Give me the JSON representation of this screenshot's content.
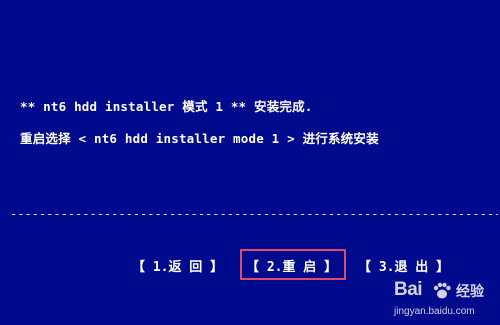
{
  "screen": {
    "line1": "** nt6 hdd installer 模式 1 ** 安装完成.",
    "line2": "重启选择 < nt6 hdd installer mode 1 > 进行系统安装",
    "divider": "--------------------------------------------------------------------------------------"
  },
  "menu": {
    "item1": "【 1.返 回 】",
    "item2": "【 2.重 启 】",
    "item3": "【 3.退 出 】"
  },
  "watermark": {
    "brand": "Bai",
    "brand2": "经验",
    "url": "jingyan.baidu.com"
  },
  "colors": {
    "background": "#000a8c",
    "text": "#ffffff",
    "highlight": "#e04a6a"
  }
}
